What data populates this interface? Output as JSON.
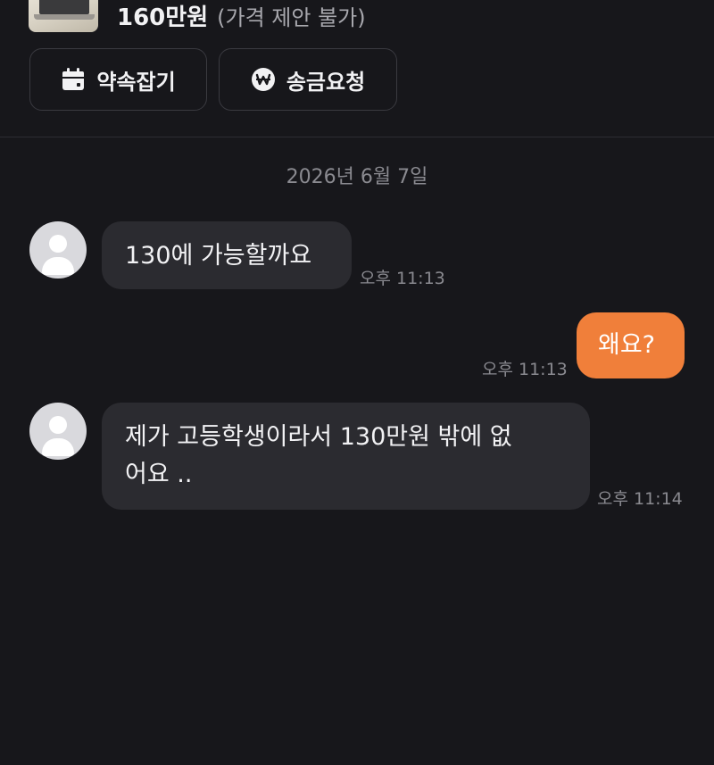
{
  "product": {
    "price": "160만원",
    "price_note": "(가격 제안 불가)"
  },
  "actions": {
    "schedule_label": "약속잡기",
    "transfer_label": "송금요청"
  },
  "chat": {
    "date": "2026년 6월 7일",
    "messages": [
      {
        "from": "other",
        "text": "130에 가능할까요",
        "time": "오후 11:13"
      },
      {
        "from": "me",
        "text": "왜요?",
        "time": "오후 11:13"
      },
      {
        "from": "other",
        "text_line1": "제가 고등학생이라서 130만원 밖에 없",
        "text_line2": "어요 ..",
        "time": "오후 11:14"
      }
    ]
  },
  "colors": {
    "background": "#17171b",
    "bubble_incoming": "#2b2b30",
    "bubble_outgoing": "#f07f3a"
  }
}
